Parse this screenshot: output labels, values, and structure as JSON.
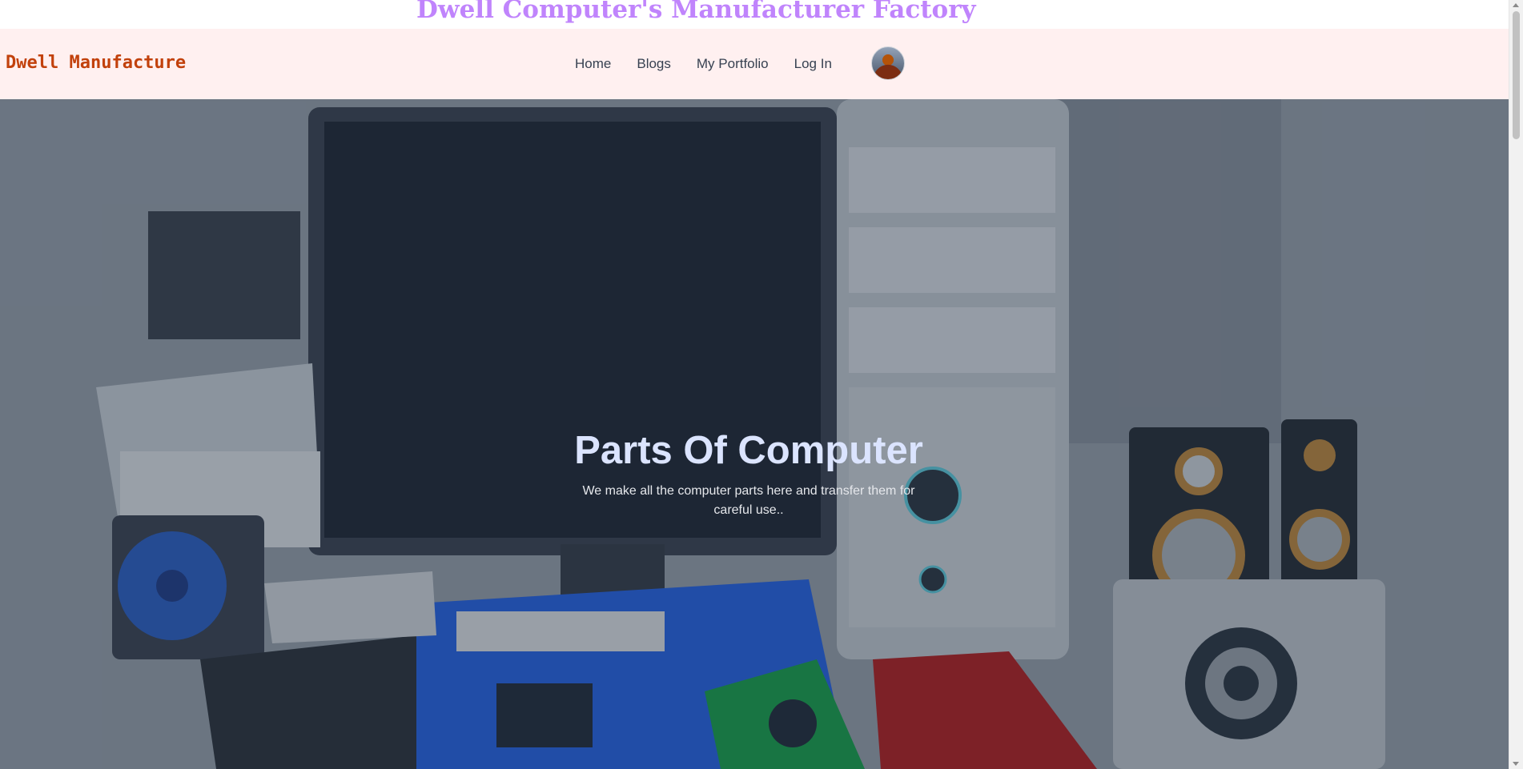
{
  "banner": {
    "title": "Dwell Computer's Manufacturer Factory"
  },
  "navbar": {
    "brand": "Dwell Manufacture",
    "links": [
      "Home",
      "Blogs",
      "My Portfolio",
      "Log In"
    ],
    "avatar_icon": "user-avatar"
  },
  "hero": {
    "title": "Parts Of Computer",
    "description": "We make all the computer parts here and transfer them for careful use..",
    "image_subject": "computer-parts-background"
  },
  "colors": {
    "banner_title": "#c084fc",
    "brand": "#c2410c",
    "navbar_bg": "#fff0f0",
    "hero_title": "#dbe4ff"
  }
}
